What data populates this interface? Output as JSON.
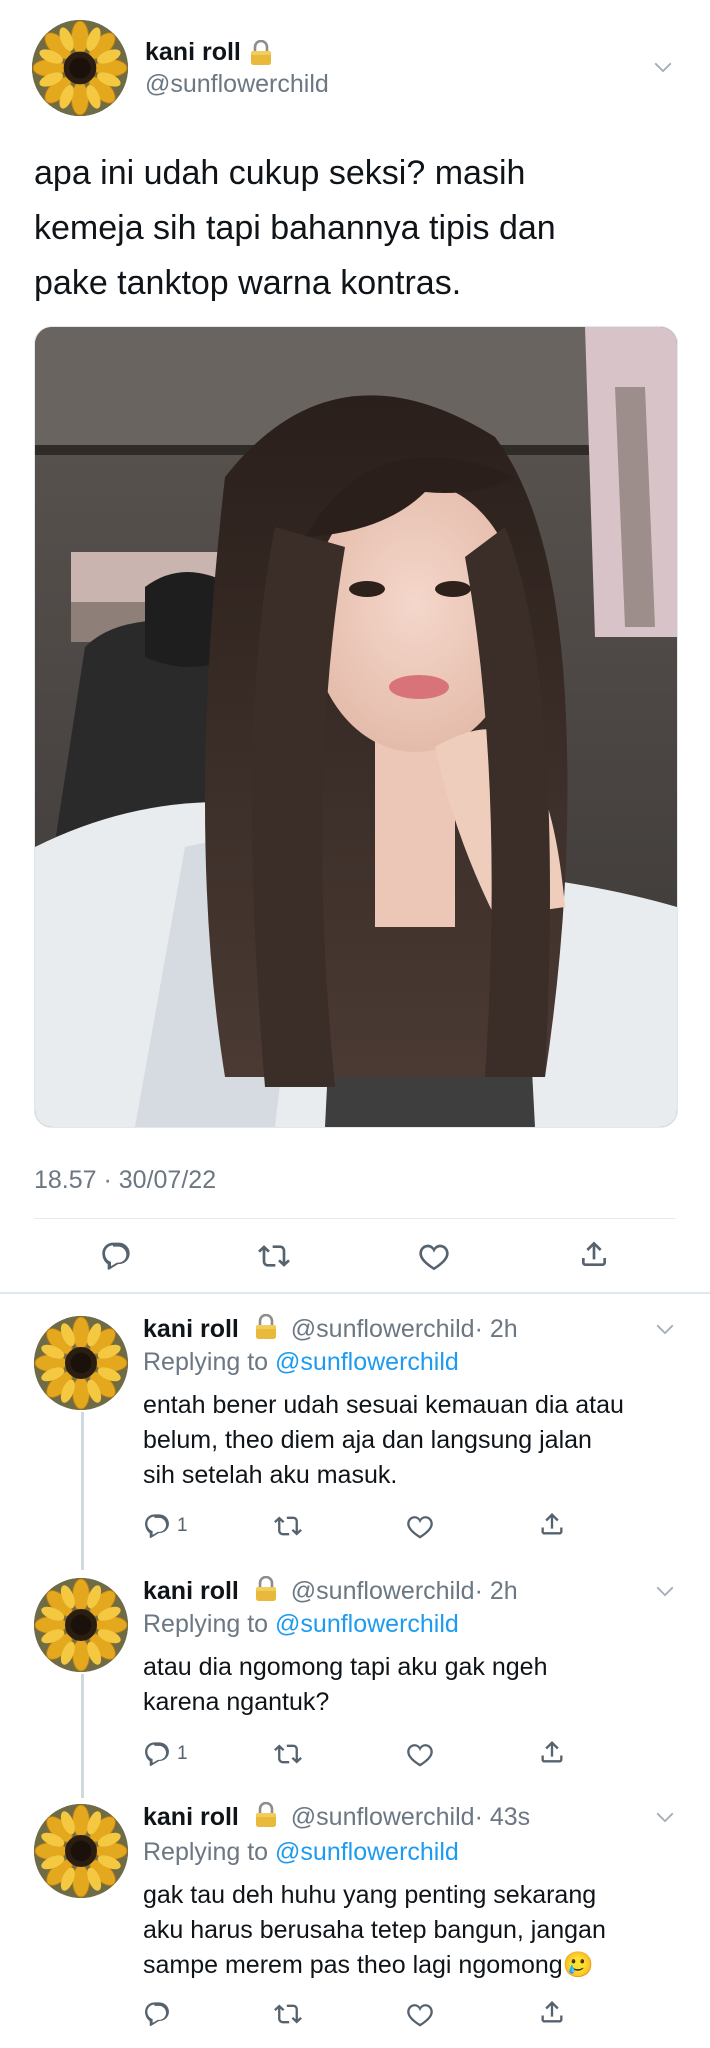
{
  "main_tweet": {
    "display_name": "kani roll",
    "handle": "@sunflowerchild",
    "text_lines": [
      "apa ini udah cukup seksi? masih",
      "kemeja sih tapi bahannya tipis dan",
      "pake tanktop warna kontras."
    ],
    "timestamp": "18.57 · 30/07/22",
    "photo": "selfie-in-car"
  },
  "replies": [
    {
      "display_name": "kani roll",
      "handle": "@sunflowerchild",
      "time": "· 2h",
      "replying_prefix": "Replying to ",
      "replying_handle": "@sunflowerchild",
      "text_lines": [
        "entah bener udah sesuai kemauan dia atau",
        "belum, theo diem aja dan langsung jalan",
        "sih setelah aku masuk."
      ],
      "reply_count": "1"
    },
    {
      "display_name": "kani roll",
      "handle": "@sunflowerchild",
      "time": "· 2h",
      "replying_prefix": "Replying to ",
      "replying_handle": "@sunflowerchild",
      "text_lines": [
        "atau dia ngomong tapi aku gak ngeh",
        "karena ngantuk?"
      ],
      "reply_count": "1"
    },
    {
      "display_name": "kani roll",
      "handle": "@sunflowerchild",
      "time": "· 43s",
      "replying_prefix": "Replying to ",
      "replying_handle": "@sunflowerchild",
      "text_lines": [
        "gak tau deh huhu yang penting sekarang",
        "aku harus berusaha tetep bangun, jangan",
        "sampe merem pas theo lagi ngomong🥲"
      ],
      "reply_count": ""
    }
  ],
  "icons": [
    "lock-icon",
    "chevron-down-icon",
    "reply-icon",
    "retweet-icon",
    "like-icon",
    "share-icon"
  ],
  "colors": {
    "link": "#1d9bf0",
    "secondary_text": "#6b7782",
    "icon": "#56636e"
  }
}
